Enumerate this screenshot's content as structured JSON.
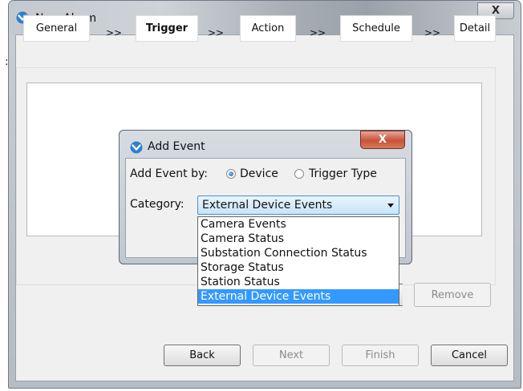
{
  "window": {
    "title": "New Alarm",
    "close_glyph": "X",
    "icon": "chevron-shield-icon"
  },
  "steps": [
    {
      "label": "General",
      "active": false
    },
    {
      "label": "Trigger",
      "active": true
    },
    {
      "label": "Action",
      "active": false
    },
    {
      "label": "Schedule",
      "active": false
    },
    {
      "label": "Detail",
      "active": false
    }
  ],
  "step_separator": ">>",
  "buttons": {
    "back": "Back",
    "next": "Next",
    "finish": "Finish",
    "cancel": "Cancel",
    "remove": "Remove"
  },
  "dialog": {
    "title": "Add Event",
    "close_glyph": "X",
    "add_event_by_label": "Add Event by:",
    "option_device": "Device",
    "option_trigger_type": "Trigger Type",
    "selected_option": "Device",
    "category_label": "Category:",
    "category_value": "External Device Events",
    "category_options": [
      "Camera Events",
      "Camera Status",
      "Substation Connection Status",
      "Storage Status",
      "Station Status",
      "External Device Events"
    ],
    "highlighted_option": "External Device Events"
  },
  "colors": {
    "selection": "#3399ff",
    "dialog_close": "#c75239",
    "select_border": "#4a90c8"
  }
}
